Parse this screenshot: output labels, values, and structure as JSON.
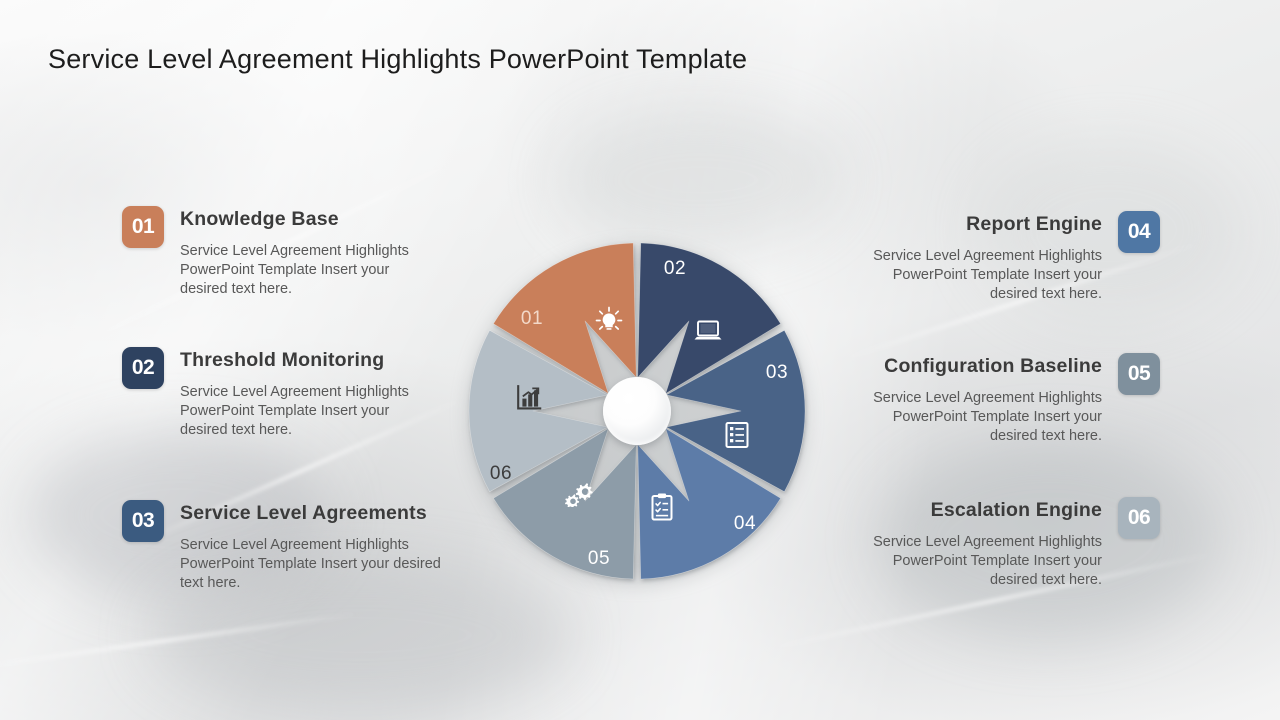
{
  "slide": {
    "title": "Service Level Agreement Highlights PowerPoint Template",
    "body_text": "Service Level Agreement Highlights PowerPoint Template Insert your desired text here."
  },
  "colors": {
    "segment_01": "#c97f5a",
    "segment_02": "#37496a",
    "segment_03": "#4a6387",
    "segment_04": "#5d7ca8",
    "segment_05": "#8d9ca8",
    "segment_06": "#b4bec6",
    "title_text": "#1d1d1d",
    "item_title_text": "#3b3b3b",
    "item_desc_text": "#585858"
  },
  "left_items": [
    {
      "number": "01",
      "title": "Knowledge Base",
      "desc": "Service Level Agreement Highlights PowerPoint Template Insert your desired text here.",
      "badge_color": "#c97f5a"
    },
    {
      "number": "02",
      "title": "Threshold Monitoring",
      "desc": "Service Level Agreement Highlights PowerPoint Template Insert your desired text here.",
      "badge_color": "#2e4260"
    },
    {
      "number": "03",
      "title": "Service Level Agreements",
      "desc": "Service Level Agreement Highlights PowerPoint Template Insert your desired text here.",
      "badge_color": "#3b5b80"
    }
  ],
  "right_items": [
    {
      "number": "04",
      "title": "Report Engine",
      "desc": "Service Level Agreement Highlights PowerPoint Template Insert your desired text here.",
      "badge_color": "#4f77a4"
    },
    {
      "number": "05",
      "title": "Configuration Baseline",
      "desc": "Service Level Agreement Highlights PowerPoint Template Insert your desired text here.",
      "badge_color": "#7f909d"
    },
    {
      "number": "06",
      "title": "Escalation Engine",
      "desc": "Service Level Agreement Highlights PowerPoint Template Insert your desired text here.",
      "badge_color": "#a8b4bd"
    }
  ],
  "chart_data": {
    "type": "pie",
    "title": "Service Level Agreement Highlights wheel",
    "categories": [
      "01",
      "02",
      "03",
      "04",
      "05",
      "06"
    ],
    "values": [
      16.67,
      16.67,
      16.67,
      16.67,
      16.67,
      16.67
    ],
    "legend": "none",
    "segments": [
      {
        "label": "01",
        "icon": "lightbulb-icon",
        "color": "#c97f5a",
        "label_color": "#f3d9c9",
        "icon_color": "#ffffff",
        "name": "Knowledge Base"
      },
      {
        "label": "02",
        "icon": "laptop-icon",
        "color": "#37496a",
        "label_color": "#ffffff",
        "icon_color": "#ffffff",
        "name": "Threshold Monitoring"
      },
      {
        "label": "03",
        "icon": "list-icon",
        "color": "#4a6387",
        "label_color": "#ffffff",
        "icon_color": "#ffffff",
        "name": "Service Level Agreements"
      },
      {
        "label": "04",
        "icon": "clipboard-icon",
        "color": "#5d7ca8",
        "label_color": "#ffffff",
        "icon_color": "#ffffff",
        "name": "Report Engine"
      },
      {
        "label": "05",
        "icon": "gears-icon",
        "color": "#8d9ca8",
        "label_color": "#ffffff",
        "icon_color": "#ffffff",
        "name": "Configuration Baseline"
      },
      {
        "label": "06",
        "icon": "bar-chart-icon",
        "color": "#b4bec6",
        "label_color": "#3d3d3d",
        "icon_color": "#3d3d3d",
        "name": "Escalation Engine"
      }
    ]
  }
}
